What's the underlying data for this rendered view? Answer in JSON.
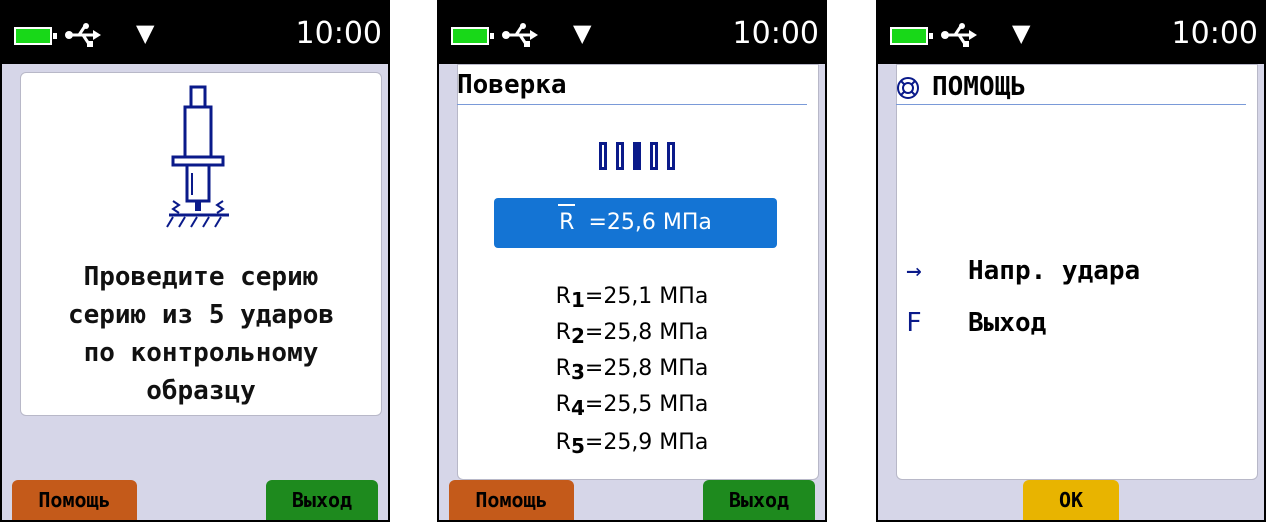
{
  "status_bar": {
    "time": "10:00",
    "icons": [
      "battery-icon",
      "usb-icon",
      "signal-down-icon"
    ],
    "battery_color": "#18d818"
  },
  "screen1": {
    "instruction_lines": [
      "Проведите серию",
      "серию из 5 ударов",
      "по контрольному",
      "образцу"
    ],
    "illustration": "hardness-tester-icon",
    "softkeys": {
      "left": "Помощь",
      "right": "Выход"
    }
  },
  "screen2": {
    "title": "Поверка",
    "stroke_count": 5,
    "result": {
      "symbol": "R",
      "value": "=25,6 МПа"
    },
    "readings": [
      {
        "index": "1",
        "value": "=25,1 МПа"
      },
      {
        "index": "2",
        "value": "=25,8 МПа"
      },
      {
        "index": "3",
        "value": "=25,8 МПа"
      },
      {
        "index": "4",
        "value": "=25,5 МПа"
      },
      {
        "index": "5",
        "value": "=25,9 МПа"
      }
    ],
    "softkeys": {
      "left": "Помощь",
      "right": "Выход"
    }
  },
  "screen3": {
    "title": "ПОМОЩЬ",
    "items": [
      {
        "key": "→",
        "label": "Напр. удара"
      },
      {
        "key": "F",
        "label": "Выход"
      }
    ],
    "softkey_center": "OK"
  },
  "colors": {
    "screen_bg": "#d6d6e8",
    "result_bg": "#1474d4",
    "help_softkey": "#c45a1a",
    "exit_softkey": "#1e8a1e",
    "ok_softkey": "#e8b400"
  }
}
